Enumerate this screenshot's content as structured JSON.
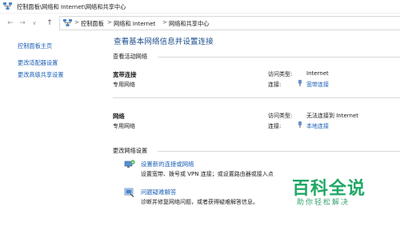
{
  "window": {
    "title": "控制面板\\网络和 Internet\\网络和共享中心"
  },
  "address_bar": {
    "back": "←",
    "forward": "→",
    "recent": "∨",
    "up": "↑",
    "crumbs": [
      "控制面板",
      "网络和 Internet",
      "网络和共享中心"
    ],
    "separator": ">"
  },
  "left_pane": {
    "links": [
      "控制面板主页",
      "更改适配器设置",
      "更改高级共享设置"
    ]
  },
  "main": {
    "title": "查看基本网络信息并设置连接",
    "active_networks_heading": "查看活动网络",
    "networks": [
      {
        "name": "宽带连接",
        "category": "专用网络",
        "access_type_label": "访问类型:",
        "access_type_value": "Internet",
        "connections_label": "连接:",
        "connection_value": "宽带连接"
      },
      {
        "name": "网络",
        "category": "专用网络",
        "access_type_label": "访问类型:",
        "access_type_value": "无法连接到 Internet",
        "connections_label": "连接:",
        "connection_value": "本地连接"
      }
    ],
    "change_settings_heading": "更改网络设置",
    "tasks": [
      {
        "icon": "network-setup-icon",
        "title": "设置新的连接或网络",
        "description": "设置宽带、拨号或 VPN 连接；或设置路由器或接入点"
      },
      {
        "icon": "troubleshoot-icon",
        "title": "问题疑难解答",
        "description": "诊断并修复网络问题，或者获得疑难解答信息。"
      }
    ]
  },
  "watermark": {
    "big": "百科全说",
    "small": "助你轻松解决"
  }
}
